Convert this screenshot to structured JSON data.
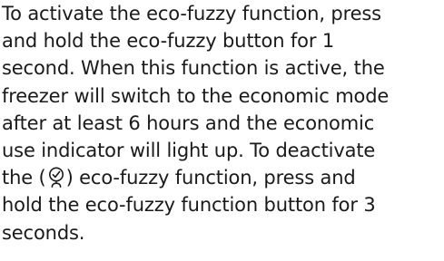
{
  "paragraph": {
    "line1": "To activate the eco-fuzzy function, press",
    "line2": "and hold the eco-fuzzy button for 1",
    "line3": "second. When this function is active, the",
    "line4": "freezer will switch to the economic mode",
    "line5": "after at least 6 hours and the economic",
    "line6": "use indicator will light up. To deactivate",
    "line7_before": "the (",
    "line7_after": ") eco-fuzzy function, press and",
    "line8": "hold the eco-fuzzy function button for 3",
    "line9": "seconds."
  },
  "icons": {
    "eco_fuzzy": "eco-fuzzy-icon"
  }
}
